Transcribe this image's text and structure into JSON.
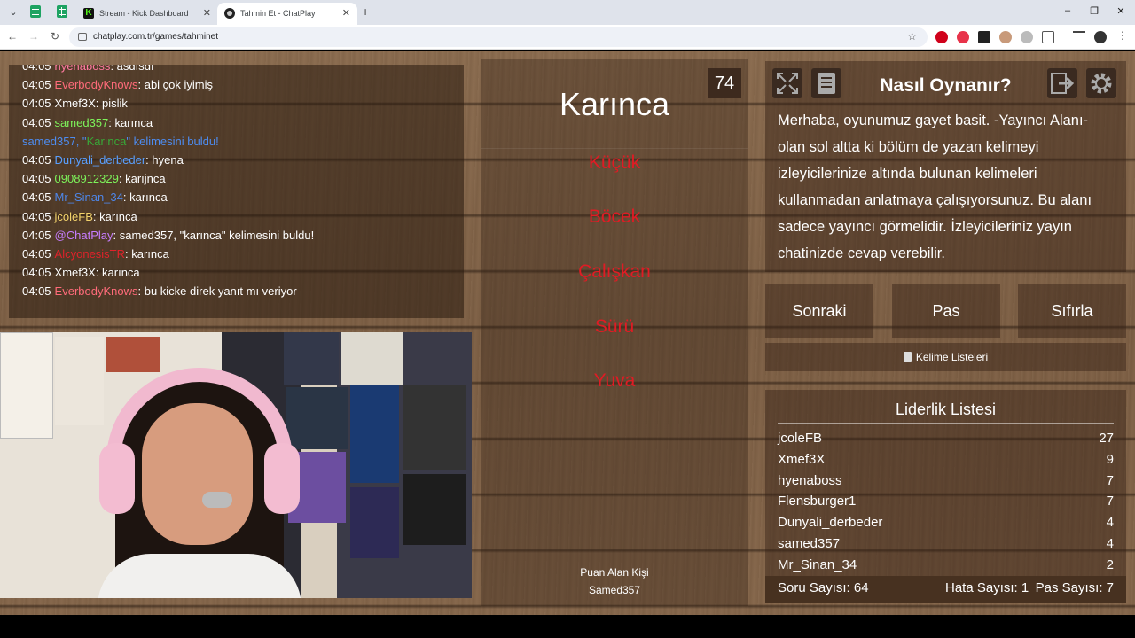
{
  "browser": {
    "tabs": [
      {
        "title": "Stream - Kick Dashboard"
      },
      {
        "title": "Tahmin Et - ChatPlay"
      }
    ],
    "url": "chatplay.com.tr/games/tahminet"
  },
  "chat": {
    "messages": [
      {
        "time": "04:05",
        "user": "hyenaboss",
        "color": "#ff7aa0",
        "text": ": asdfsdf"
      },
      {
        "time": "04:05",
        "user": "EverbodyKnows",
        "color": "#ff6b7a",
        "text": ": abi çok iyimiş"
      },
      {
        "time": "04:05",
        "user": "Xmef3X",
        "color": "#ffffff",
        "text": ": pislik"
      },
      {
        "time": "04:05",
        "user": "samed357",
        "color": "#7df25a",
        "text": ": karınca"
      },
      {
        "system": true,
        "pre": "samed357, \"",
        "word": "Karınca",
        "post": "\" kelimesini buldu!"
      },
      {
        "time": "04:05",
        "user": "Dunyali_derbeder",
        "color": "#5aa0ff",
        "text": ": hyena"
      },
      {
        "time": "04:05",
        "user": "0908912329",
        "color": "#7df25a",
        "text": ": karıjnca"
      },
      {
        "time": "04:05",
        "user": "Mr_Sinan_34",
        "color": "#4e86e8",
        "text": ": karınca"
      },
      {
        "time": "04:05",
        "user": "jcoleFB",
        "color": "#f2d26b",
        "text": ": karınca"
      },
      {
        "time": "04:05",
        "user": "@ChatPlay",
        "color": "#c77dff",
        "text": ": samed357, \"karınca\" kelimesini buldu!"
      },
      {
        "time": "04:05",
        "user": "AlcyonesisTR",
        "color": "#e0222a",
        "text": ": karınca"
      },
      {
        "time": "04:05",
        "user": "Xmef3X",
        "color": "#ffffff",
        "text": ": karınca"
      },
      {
        "time": "04:05",
        "user": "EverbodyKnows",
        "color": "#ff6b7a",
        "text": ": bu kicke direk yanıt mı veriyor"
      }
    ]
  },
  "game": {
    "counter": "74",
    "word": "Karınca",
    "taboo": [
      "Küçük",
      "Böcek",
      "Çalışkan",
      "Sürü",
      "Yuva"
    ],
    "scorer_label": "Puan Alan Kişi",
    "scorer": "Samed357"
  },
  "howto": {
    "title": "Nasıl Oynanır?",
    "text": "Merhaba, oyunumuz gayet basit. -Yayıncı Alanı- olan sol altta ki bölüm de yazan kelimeyi izleyicilerinize altında bulunan kelimeleri kullanmadan anlatmaya çalışıyorsunuz. Bu alanı sadece yayıncı görmelidir. İzleyicileriniz yayın chatinizde cevap verebilir."
  },
  "actions": {
    "next": "Sonraki",
    "pass": "Pas",
    "reset": "Sıfırla",
    "word_lists": "Kelime Listeleri"
  },
  "leaderboard": {
    "title": "Liderlik Listesi",
    "rows": [
      {
        "name": "jcoleFB",
        "score": "27"
      },
      {
        "name": "Xmef3X",
        "score": "9"
      },
      {
        "name": "hyenaboss",
        "score": "7"
      },
      {
        "name": "Flensburger1",
        "score": "7"
      },
      {
        "name": "Dunyali_derbeder",
        "score": "4"
      },
      {
        "name": "samed357",
        "score": "4"
      },
      {
        "name": "Mr_Sinan_34",
        "score": "2"
      }
    ],
    "questions": "Soru Sayısı: 64",
    "errors": "Hata Sayısı: 1",
    "passes": "Pas Sayısı: 7"
  }
}
